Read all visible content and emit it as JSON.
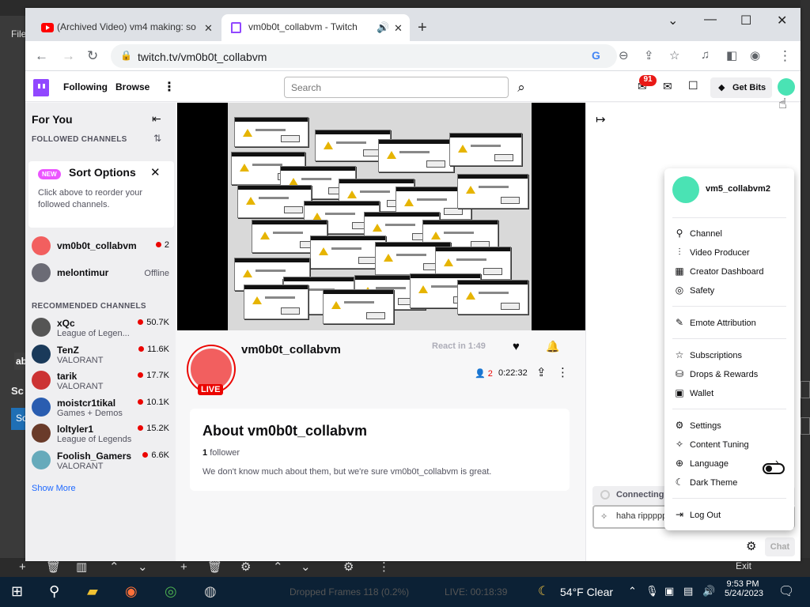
{
  "obs": {
    "file_menu": "File",
    "exit_label": "Exit",
    "left_labels": [
      "ab",
      "Sc",
      "Sc"
    ]
  },
  "browser": {
    "tabs": [
      {
        "title": "(Archived Video) vm4 making: so",
        "active": false
      },
      {
        "title": "vm0b0t_collabvm - Twitch",
        "active": true
      }
    ],
    "url": "twitch.tv/vm0b0t_collabvm"
  },
  "twitch": {
    "nav": {
      "following": "Following",
      "browse": "Browse",
      "search_placeholder": "Search",
      "notif_count": "91",
      "get_bits": "Get Bits"
    },
    "sidebar": {
      "title": "For You",
      "followed_header": "FOLLOWED CHANNELS",
      "sort_card": {
        "badge": "NEW",
        "title": "Sort Options",
        "text": "Click above to reorder your followed channels."
      },
      "followed": [
        {
          "name": "vm0b0t_collabvm",
          "viewers": "2",
          "color": "#f25f5f"
        },
        {
          "name": "melontimur",
          "status": "Offline",
          "color": "#6b6b75"
        }
      ],
      "recommended_header": "RECOMMENDED CHANNELS",
      "recommended": [
        {
          "name": "xQc",
          "game": "League of Legen...",
          "viewers": "50.7K",
          "color": "#555"
        },
        {
          "name": "TenZ",
          "game": "VALORANT",
          "viewers": "11.6K",
          "color": "#1a3a5a"
        },
        {
          "name": "tarik",
          "game": "VALORANT",
          "viewers": "17.7K",
          "color": "#c33"
        },
        {
          "name": "moistcr1tikal",
          "game": "Games + Demos",
          "viewers": "10.1K",
          "color": "#2a5db0"
        },
        {
          "name": "loltyler1",
          "game": "League of Legends",
          "viewers": "15.2K",
          "color": "#6a3b2a"
        },
        {
          "name": "Foolish_Gamers",
          "game": "VALORANT",
          "viewers": "6.6K",
          "color": "#6ab"
        }
      ],
      "show_more": "Show More"
    },
    "channel": {
      "name": "vm0b0t_collabvm",
      "live": "LIVE",
      "react_label": "React in 1:49",
      "viewers": "2",
      "uptime": "0:22:32",
      "about_title": "About vm0b0t_collabvm",
      "followers_count": "1",
      "followers_label": "follower",
      "about_text": "We don't know much about them, but we're sure vm0b0t_collabvm is great."
    },
    "chat": {
      "status": "Connecting to Chat",
      "input_value": "haha rippppp",
      "chat_button": "Chat"
    },
    "user_menu": {
      "username": "vm5_collabvm2",
      "items": [
        "Channel",
        "Video Producer",
        "Creator Dashboard",
        "Safety",
        "Emote Attribution",
        "Subscriptions",
        "Drops & Rewards",
        "Wallet",
        "Settings",
        "Content Tuning",
        "Language",
        "Dark Theme",
        "Log Out"
      ],
      "dark_theme_on": true
    }
  },
  "taskbar": {
    "dropped_frames": "Dropped Frames 118 (0.2%)",
    "live": "LIVE: 00:18:39",
    "weather": "54°F  Clear",
    "time": "9:53 PM",
    "date": "5/24/2023"
  }
}
